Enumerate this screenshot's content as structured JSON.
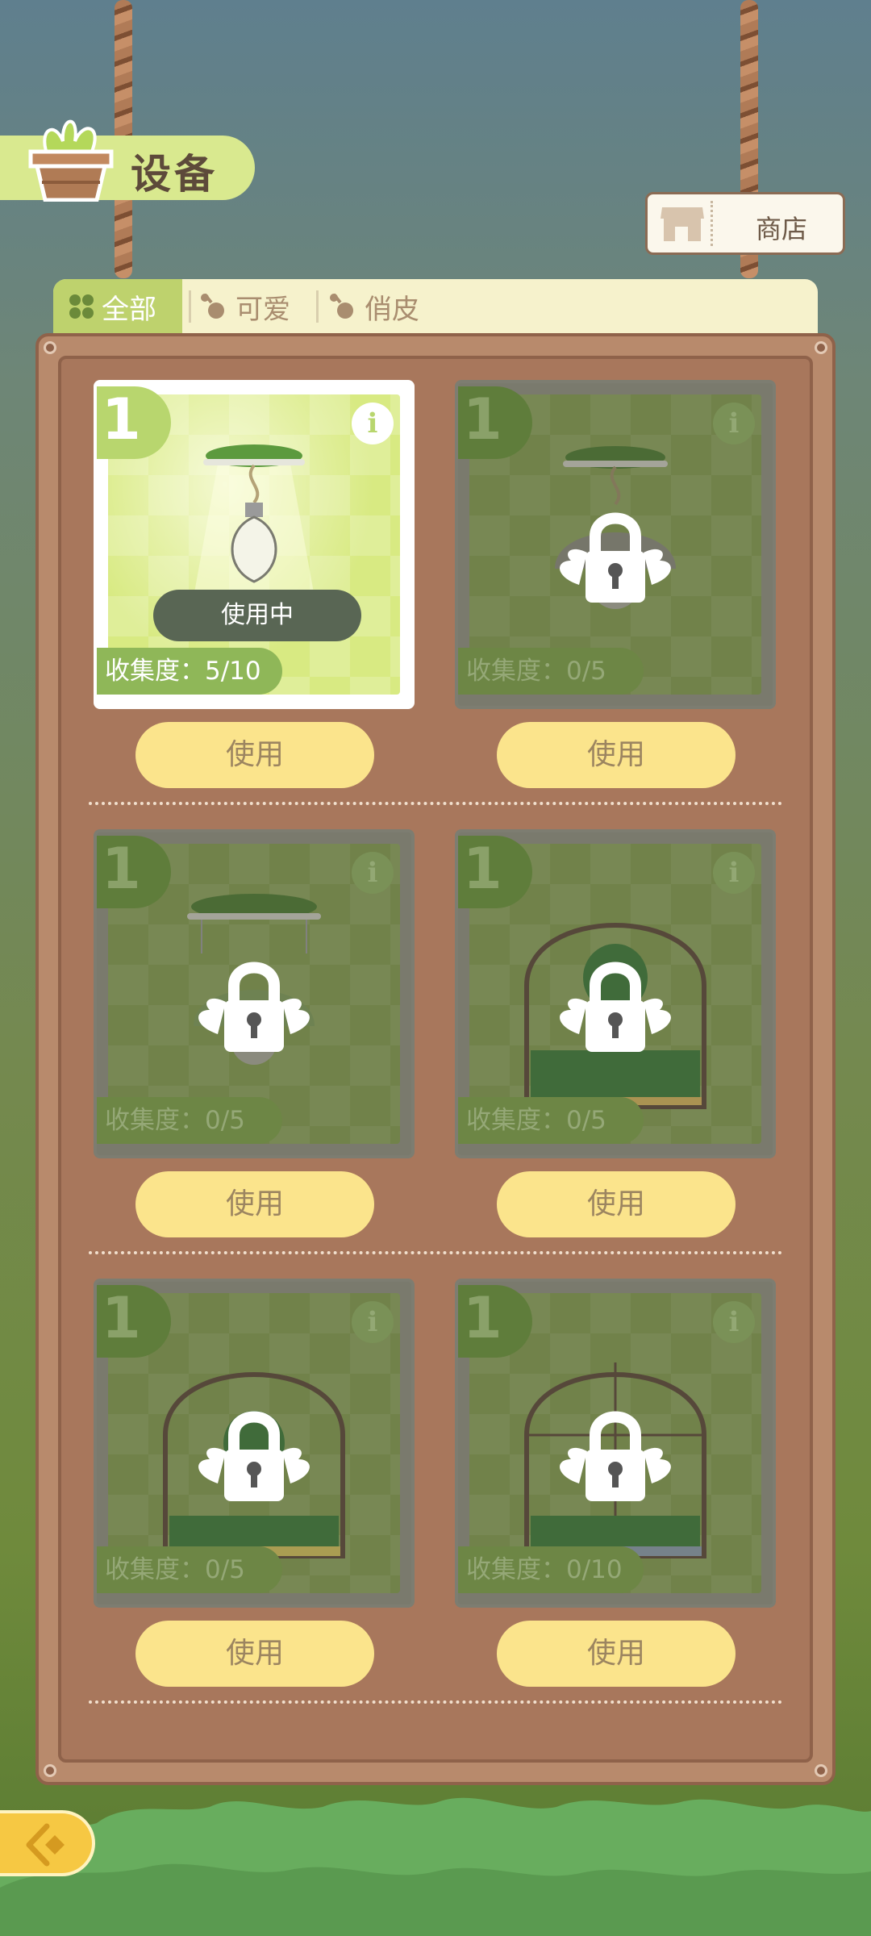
{
  "header": {
    "title": "设备",
    "shop_label": "商店"
  },
  "tabs": [
    {
      "label": "全部",
      "active": true
    },
    {
      "label": "可爱",
      "active": false
    },
    {
      "label": "俏皮",
      "active": false
    }
  ],
  "cards": [
    {
      "level": "1",
      "collection": "收集度：5/10",
      "status": "使用中",
      "use_label": "使用",
      "locked": false,
      "selected": true
    },
    {
      "level": "1",
      "collection": "收集度：0/5",
      "use_label": "使用",
      "locked": true
    },
    {
      "level": "1",
      "collection": "收集度：0/5",
      "use_label": "使用",
      "locked": true
    },
    {
      "level": "1",
      "collection": "收集度：0/5",
      "use_label": "使用",
      "locked": true
    },
    {
      "level": "1",
      "collection": "收集度：0/5",
      "use_label": "使用",
      "locked": true
    },
    {
      "level": "1",
      "collection": "收集度：0/10",
      "use_label": "使用",
      "locked": true
    }
  ],
  "icons": {
    "title": "plant-pot-icon",
    "shop": "shop-icon",
    "tab_all": "grid-icon",
    "tab_cute": "sprout-icon",
    "tab_playful": "sprout-icon",
    "info": "info-icon",
    "lock": "winged-lock-icon",
    "back": "back-arrow-icon"
  },
  "colors": {
    "accent_green": "#bed26d",
    "button_yellow": "#fbe48c",
    "board_brown": "#a8775c"
  }
}
